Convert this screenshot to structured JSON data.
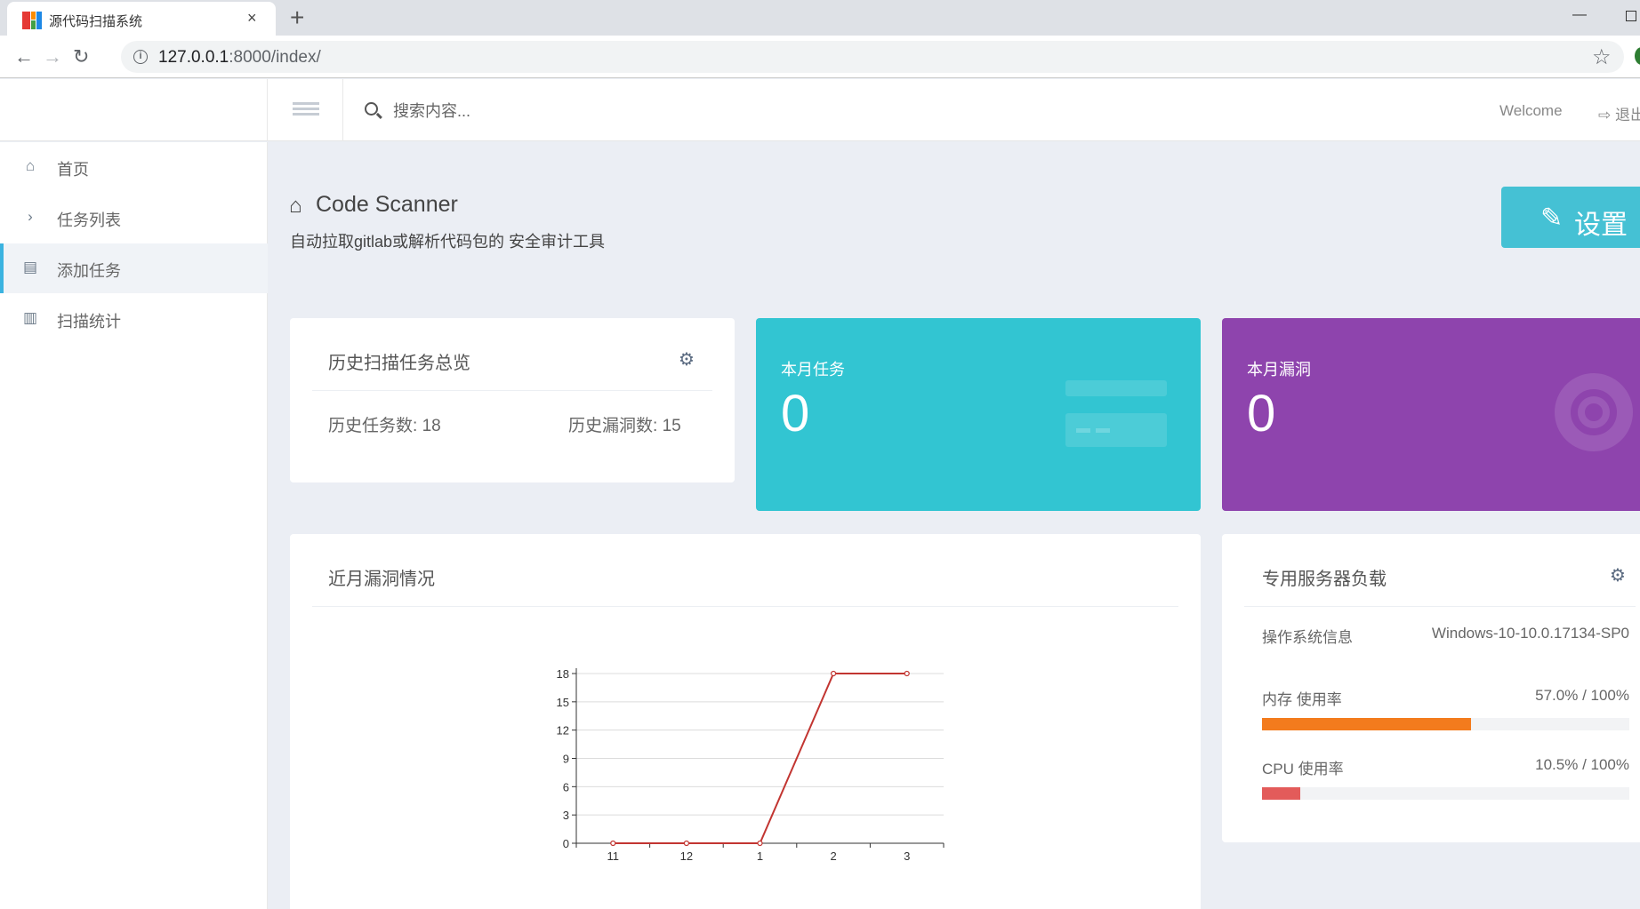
{
  "browser": {
    "tab_title": "源代码扫描系统",
    "url_host": "127.0.0.1",
    "url_path": ":8000/index/",
    "close_glyph": "×",
    "newtab_glyph": "+",
    "min_glyph": "—"
  },
  "header": {
    "search_placeholder": "搜索内容...",
    "welcome": "Welcome",
    "logout": "退出"
  },
  "sidebar": {
    "items": [
      {
        "label": "首页",
        "icon": "home-icon"
      },
      {
        "label": "任务列表",
        "icon": "chevron-right-icon"
      },
      {
        "label": "添加任务",
        "icon": "form-icon"
      },
      {
        "label": "扫描统计",
        "icon": "bar-chart-icon"
      }
    ],
    "active_index": 2
  },
  "page": {
    "title": "Code Scanner",
    "subtitle": "自动拉取gitlab或解析代码包的 安全审计工具",
    "settings_button": "设置"
  },
  "history_card": {
    "title": "历史扫描任务总览",
    "tasks_label": "历史任务数:",
    "tasks_value": "18",
    "vulns_label": "历史漏洞数:",
    "vulns_value": "15"
  },
  "month_tasks": {
    "label": "本月任务",
    "value": "0",
    "color": "#32c5d2"
  },
  "month_vulns": {
    "label": "本月漏洞",
    "value": "0",
    "color": "#8e44ad"
  },
  "chart_card": {
    "title": "近月漏洞情况"
  },
  "chart_data": {
    "type": "line",
    "categories": [
      "11",
      "12",
      "1",
      "2",
      "3"
    ],
    "series": [
      {
        "values": [
          0,
          0,
          0,
          18,
          18
        ],
        "color": "#c23531"
      }
    ],
    "ylim": [
      0,
      18
    ],
    "yticks": [
      0,
      3,
      6,
      9,
      12,
      15,
      18
    ],
    "grid": true
  },
  "server_card": {
    "title": "专用服务器负载",
    "os_label": "操作系统信息",
    "os_value": "Windows-10-10.0.17134-SP0",
    "mem_label": "内存 使用率",
    "mem_value": "57.0% / 100%",
    "mem_percent": 57.0,
    "mem_color": "#f37b1d",
    "cpu_label": "CPU 使用率",
    "cpu_value": "10.5% / 100%",
    "cpu_percent": 10.5,
    "cpu_color": "#e35b5a"
  }
}
